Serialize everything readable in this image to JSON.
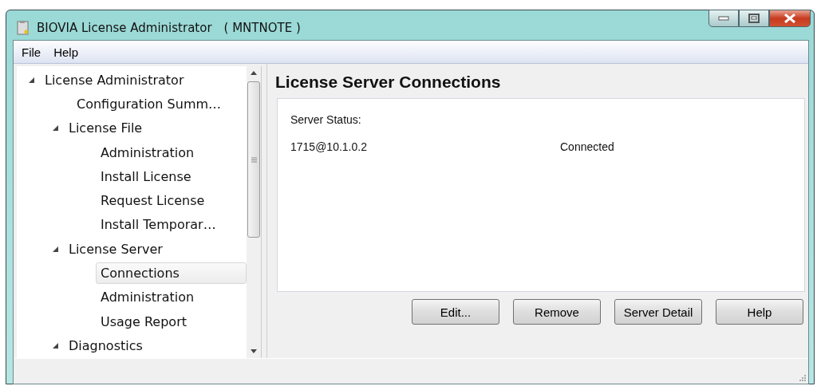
{
  "window": {
    "title": "BIOVIA License Administrator　( MNTNOTE )"
  },
  "menu": [
    {
      "label": "File"
    },
    {
      "label": "Help"
    }
  ],
  "tree": [
    {
      "label": "License Administrator",
      "expanded": true,
      "selected": false,
      "children": [
        {
          "label": "Configuration Summ…",
          "selected": false
        },
        {
          "label": "License File",
          "expanded": true,
          "selected": false,
          "children": [
            {
              "label": "Administration",
              "selected": false
            },
            {
              "label": "Install License",
              "selected": false
            },
            {
              "label": "Request License",
              "selected": false
            },
            {
              "label": "Install Temporar…",
              "selected": false
            }
          ]
        },
        {
          "label": "License Server",
          "expanded": true,
          "selected": false,
          "children": [
            {
              "label": "Connections",
              "selected": true
            },
            {
              "label": "Administration",
              "selected": false
            },
            {
              "label": "Usage Report",
              "selected": false
            }
          ]
        },
        {
          "label": "Diagnostics",
          "expanded": true,
          "selected": false
        }
      ]
    }
  ],
  "panel": {
    "title": "License Server Connections",
    "status_label": "Server Status:",
    "servers": [
      {
        "address": "1715@10.1.0.2",
        "status": "Connected"
      }
    ]
  },
  "buttons": [
    {
      "label": "Edit..."
    },
    {
      "label": "Remove"
    },
    {
      "label": "Server Detail"
    },
    {
      "label": "Help"
    }
  ]
}
